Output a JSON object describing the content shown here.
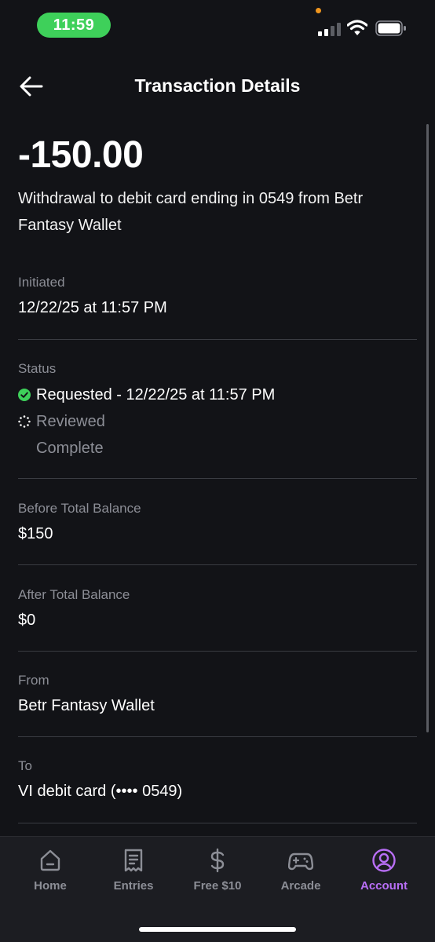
{
  "status_bar": {
    "time": "11:59"
  },
  "header": {
    "title": "Transaction Details"
  },
  "transaction": {
    "amount": "-150.00",
    "description": "Withdrawal to debit card ending in 0549 from Betr Fantasy Wallet"
  },
  "initiated": {
    "label": "Initiated",
    "value": "12/22/25 at 11:57 PM"
  },
  "status": {
    "label": "Status",
    "steps": [
      {
        "label": "Requested - 12/22/25 at 11:57 PM",
        "state": "done"
      },
      {
        "label": "Reviewed",
        "state": "in-progress"
      },
      {
        "label": "Complete",
        "state": "pending"
      }
    ]
  },
  "before_balance": {
    "label": "Before Total Balance",
    "value": "$150"
  },
  "after_balance": {
    "label": "After Total Balance",
    "value": "$0"
  },
  "from": {
    "label": "From",
    "value": "Betr Fantasy Wallet"
  },
  "to": {
    "label": "To",
    "value": "VI debit card (•••• 0549)"
  },
  "tabs": [
    {
      "label": "Home",
      "icon": "home-icon",
      "active": false
    },
    {
      "label": "Entries",
      "icon": "receipt-icon",
      "active": false
    },
    {
      "label": "Free $10",
      "icon": "dollar-icon",
      "active": false
    },
    {
      "label": "Arcade",
      "icon": "gamepad-icon",
      "active": false
    },
    {
      "label": "Account",
      "icon": "account-icon",
      "active": true
    }
  ],
  "colors": {
    "background": "#121317",
    "accent": "#b86ef5",
    "success": "#3ed05a",
    "muted_text": "#8c8e96"
  }
}
